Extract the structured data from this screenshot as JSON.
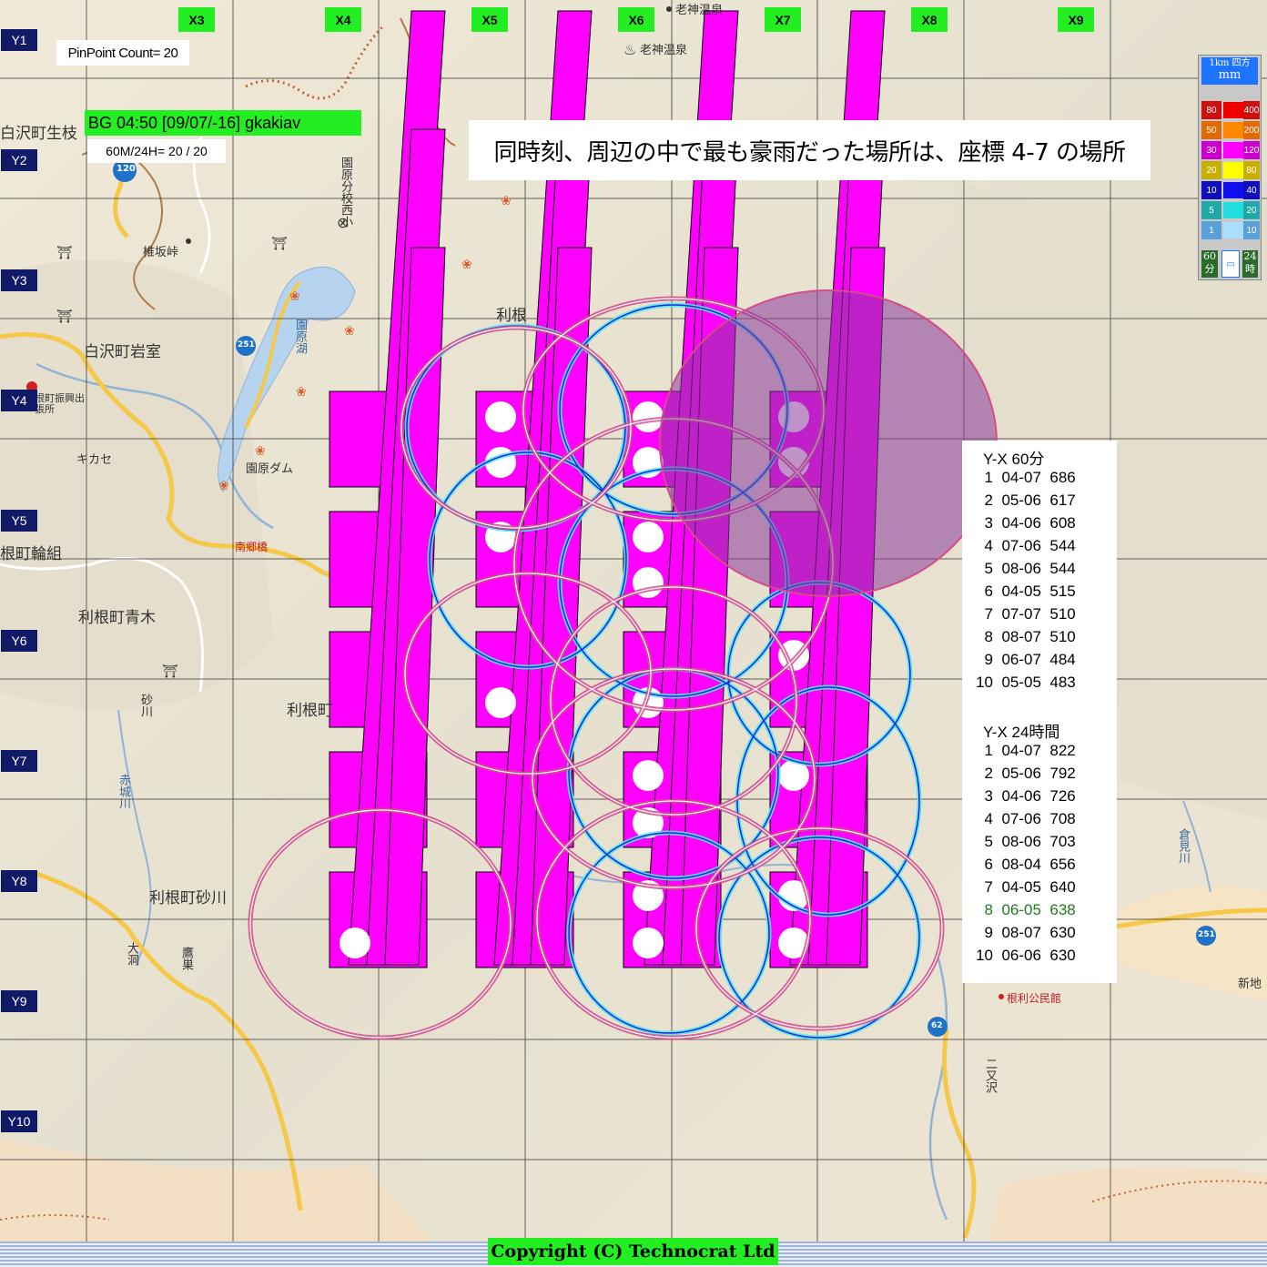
{
  "pin_count": "PinPoint Count= 20",
  "bg_label": "BG  04:50 [09/07/-16]  gkakiav",
  "m24_label": "60M/24H= 20 / 20",
  "banner": "同時刻、周辺の中で最も豪雨だった場所は、座標 4-7 の場所",
  "columns": [
    "X3",
    "X4",
    "X5",
    "X6",
    "X7",
    "X8",
    "X9"
  ],
  "rows": [
    "Y1",
    "Y2",
    "Y3",
    "Y4",
    "Y5",
    "Y6",
    "Y7",
    "Y8",
    "Y9",
    "Y10"
  ],
  "places": {
    "shirasawa_namaeda": "白沢町生枝",
    "shiinozaka": "椎坂峠",
    "shirasawa_iwamuro": "白沢町岩室",
    "sonohara_dam": "園原ダム",
    "sonohara_lake": "園原湖",
    "sonohara_school": "園原分校西小",
    "tone_wagumi": "根町輪組",
    "tone_aoki": "利根町青木",
    "tone_cho": "利根町",
    "tone_sunagawa": "利根町砂川",
    "sunagawa_river": "砂川",
    "akagi_river": "赤城川",
    "kakase": "キカセ",
    "oigami_onsen": "老神温泉",
    "oigami_onsen_top": "老神温泉",
    "tone_top": "利根",
    "kuramigawa": "倉見川",
    "futamatasawa": "二又沢",
    "oobora": "大洞",
    "takasu": "鷹巣",
    "nangou_bridge": "南郷橋",
    "nei_hall": "根利公民館",
    "shinji": "新地",
    "branch_office": "根町振興出張所",
    "road_120": "120",
    "road_251": "251",
    "road_62": "62"
  },
  "legend": {
    "title": "1km 四方",
    "unit": "mm",
    "rows": [
      {
        "left": "80",
        "right": "400",
        "color": "#ee0000"
      },
      {
        "left": "50",
        "right": "200",
        "color": "#ff8800"
      },
      {
        "left": "30",
        "right": "120",
        "color": "#ff00ff"
      },
      {
        "left": "20",
        "right": "80",
        "color": "#ffff00"
      },
      {
        "left": "10",
        "right": "40",
        "color": "#1010ee"
      },
      {
        "left": "5",
        "right": "20",
        "color": "#22dddd"
      },
      {
        "left": "1",
        "right": "10",
        "color": "#aaddff"
      }
    ],
    "foot_left": "60分",
    "foot_right": "24時"
  },
  "ranking_60": {
    "title": "Y-X  60分",
    "items": [
      {
        "rank": "1",
        "coord": "04-07",
        "value": "686"
      },
      {
        "rank": "2",
        "coord": "05-06",
        "value": "617"
      },
      {
        "rank": "3",
        "coord": "04-06",
        "value": "608"
      },
      {
        "rank": "4",
        "coord": "07-06",
        "value": "544"
      },
      {
        "rank": "5",
        "coord": "08-06",
        "value": "544"
      },
      {
        "rank": "6",
        "coord": "04-05",
        "value": "515"
      },
      {
        "rank": "7",
        "coord": "07-07",
        "value": "510"
      },
      {
        "rank": "8",
        "coord": "08-07",
        "value": "510"
      },
      {
        "rank": "9",
        "coord": "06-07",
        "value": "484"
      },
      {
        "rank": "10",
        "coord": "05-05",
        "value": "483"
      }
    ]
  },
  "ranking_24": {
    "title": "Y-X  24時間",
    "items": [
      {
        "rank": "1",
        "coord": "04-07",
        "value": "822"
      },
      {
        "rank": "2",
        "coord": "05-06",
        "value": "792"
      },
      {
        "rank": "3",
        "coord": "04-06",
        "value": "726"
      },
      {
        "rank": "4",
        "coord": "07-06",
        "value": "708"
      },
      {
        "rank": "5",
        "coord": "08-06",
        "value": "703"
      },
      {
        "rank": "6",
        "coord": "08-04",
        "value": "656"
      },
      {
        "rank": "7",
        "coord": "04-05",
        "value": "640"
      },
      {
        "rank": "8",
        "coord": "06-05",
        "value": "638",
        "highlight": true
      },
      {
        "rank": "9",
        "coord": "08-07",
        "value": "630"
      },
      {
        "rank": "10",
        "coord": "06-06",
        "value": "630"
      }
    ]
  },
  "copyright": "Copyright (C) Technocrat Ltd"
}
